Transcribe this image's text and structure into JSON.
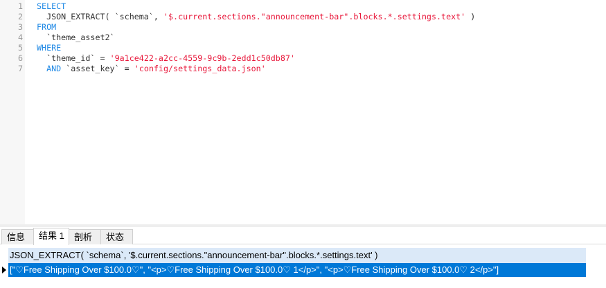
{
  "editor": {
    "line_numbers": [
      "1",
      "2",
      "3",
      "4",
      "5",
      "6",
      "7"
    ],
    "lines": [
      {
        "kw": "SELECT"
      },
      {
        "plain": "  JSON_EXTRACT( `schema`, ",
        "str": "'$.current.sections.\"announcement-bar\".blocks.*.settings.text'",
        "tail": " )"
      },
      {
        "kw": "FROM"
      },
      {
        "plain": "  `theme_asset2`"
      },
      {
        "kw": "WHERE"
      },
      {
        "plain": "  `theme_id` = ",
        "str": "'9a1ce422-a2cc-4559-9c9b-2edd1c50db87'"
      },
      {
        "kw": "  AND",
        "plain": " `asset_key` = ",
        "str": "'config/settings_data.json'"
      }
    ]
  },
  "tabs": [
    "信息",
    "结果 1",
    "剖析",
    "状态"
  ],
  "result": {
    "column": "JSON_EXTRACT( `schema`, '$.current.sections.\"announcement-bar\".blocks.*.settings.text' )",
    "value": "[\"♡Free Shipping Over $100.0♡\", \"<p>♡Free Shipping Over $100.0♡ 1</p>\", \"<p>♡Free Shipping Over $100.0♡ 2</p>\"]"
  },
  "colors": {
    "keyword": "#1e88e5",
    "string": "#e8173a",
    "selected_row": "#0078d7",
    "header": "#dbe9f8"
  }
}
